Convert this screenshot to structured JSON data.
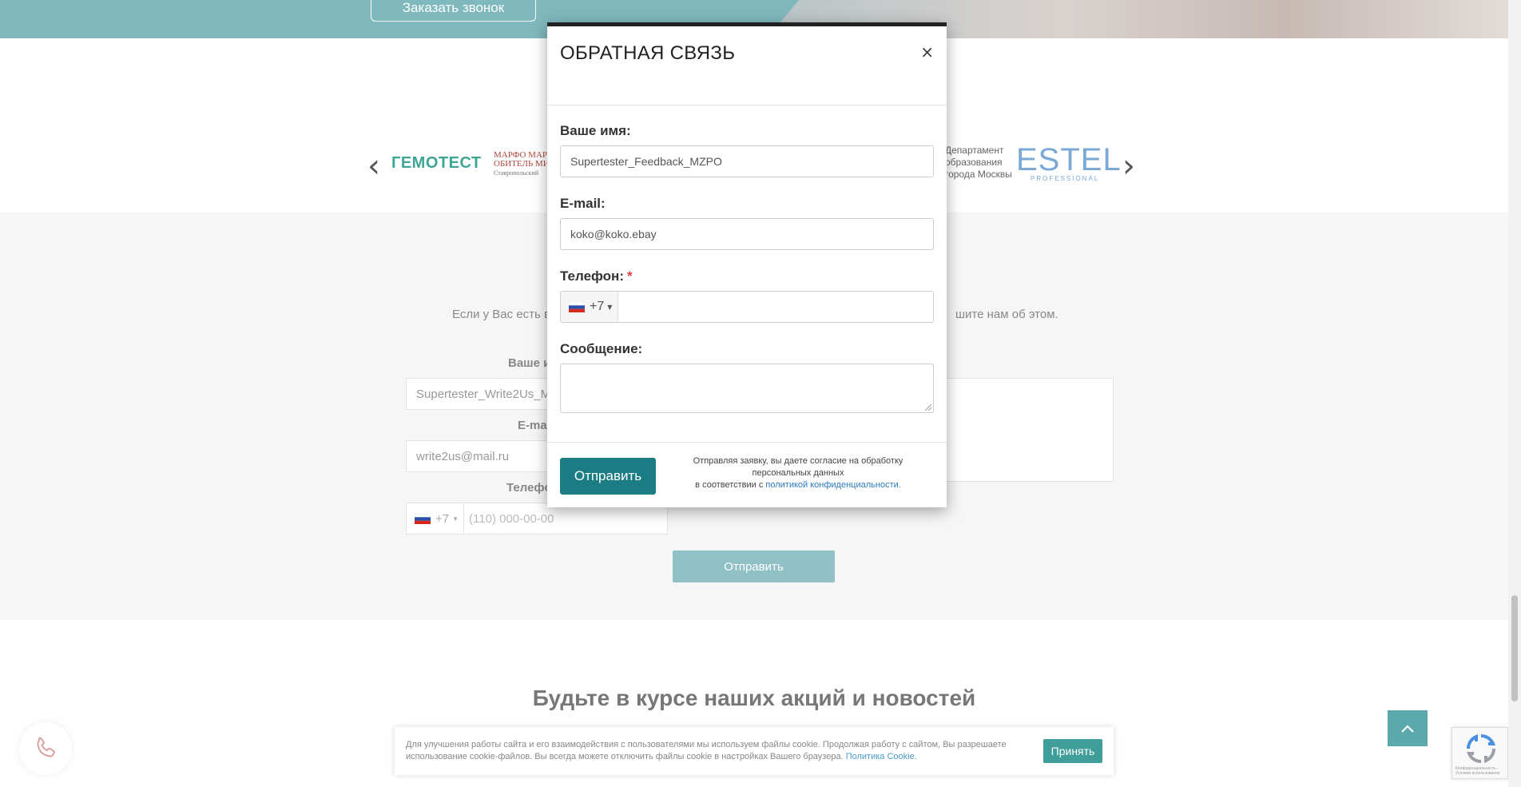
{
  "hero": {
    "call_button": "Заказать звонок"
  },
  "partners": {
    "logos": {
      "gemotest": "ГЕМОТЕСТ",
      "marfo_line1": "МАРФО МАРИ",
      "marfo_line2": "ОБИТЕЛЬ МИЛ",
      "marfo_sub": "Ставропольский",
      "dept_line1": "Департамент",
      "dept_line2": "образования",
      "dept_line3": "города Москвы",
      "estel": "ESTEL",
      "estel_sub": "PROFESSIONAL"
    }
  },
  "write_us": {
    "intro_left": "Если у Вас есть в",
    "intro_right": "шите нам об этом.",
    "name_label": "Ваше и",
    "name_value": "Supertester_Write2Us_M",
    "email_label": "E-ma",
    "email_value": "write2us@mail.ru",
    "phone_label": "Телефо",
    "phone_code": "+7",
    "phone_placeholder": "(110) 000-00-00",
    "send_label": "Отправить"
  },
  "news": {
    "title": "Будьте в курсе наших акций и новостей"
  },
  "cookie": {
    "text": "Для улучшения работы сайта и его взаимодействия с пользователями мы используем файлы cookie. Продолжая работу с сайтом, Вы разрешаете использование cookie-файлов. Вы всегда можете отключить файлы cookie в настройках Вашего браузера.",
    "link": "Политика Cookie.",
    "accept": "Принять"
  },
  "recaptcha": {
    "text": "Конфиденциальность - Условия использования"
  },
  "modal": {
    "title": "ОБРАТНАЯ СВЯЗЬ",
    "close": "×",
    "name_label": "Ваше имя:",
    "name_value": "Supertester_Feedback_MZPO",
    "email_label": "E-mail:",
    "email_value": "koko@koko.ebay",
    "phone_label": "Телефон:",
    "phone_required": "*",
    "phone_code": "+7",
    "message_label": "Сообщение:",
    "send_label": "Отправить",
    "consent_line1": "Отправляя заявку, вы даете согласие на обработку персональных данных",
    "consent_line2": "в соответствии с",
    "consent_link": "политикой конфиденциальности."
  },
  "colors": {
    "accent": "#1b7c84",
    "hero_bg": "#7fb8bd",
    "required": "#e54040",
    "link": "#2a7ac0"
  }
}
